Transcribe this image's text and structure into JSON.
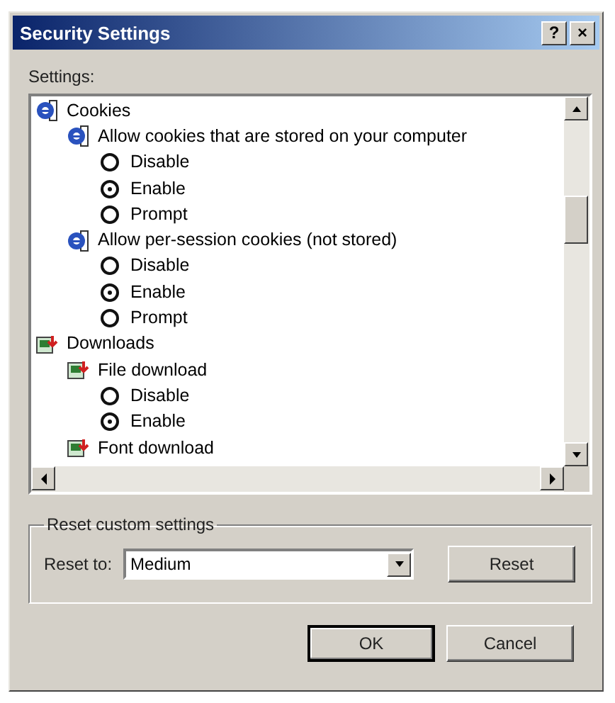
{
  "window": {
    "title": "Security Settings",
    "help_button": "?",
    "close_button": "×"
  },
  "settings_label": "Settings:",
  "settings": [
    {
      "kind": "cookies",
      "label": "Cookies",
      "children": [
        {
          "kind": "cookies",
          "label": "Allow cookies that are stored on your computer",
          "options": [
            {
              "label": "Disable",
              "selected": false
            },
            {
              "label": "Enable",
              "selected": true
            },
            {
              "label": "Prompt",
              "selected": false
            }
          ]
        },
        {
          "kind": "cookies",
          "label": "Allow per-session cookies (not stored)",
          "options": [
            {
              "label": "Disable",
              "selected": false
            },
            {
              "label": "Enable",
              "selected": true
            },
            {
              "label": "Prompt",
              "selected": false
            }
          ]
        }
      ]
    },
    {
      "kind": "downloads",
      "label": "Downloads",
      "children": [
        {
          "kind": "downloads",
          "label": "File download",
          "options": [
            {
              "label": "Disable",
              "selected": false
            },
            {
              "label": "Enable",
              "selected": true
            }
          ]
        },
        {
          "kind": "downloads",
          "label": "Font download"
        }
      ]
    }
  ],
  "reset_group": {
    "title": "Reset custom settings",
    "label": "Reset to:",
    "value": "Medium",
    "button": "Reset"
  },
  "buttons": [
    {
      "label": "OK",
      "default": true
    },
    {
      "label": "Cancel",
      "default": false
    }
  ]
}
